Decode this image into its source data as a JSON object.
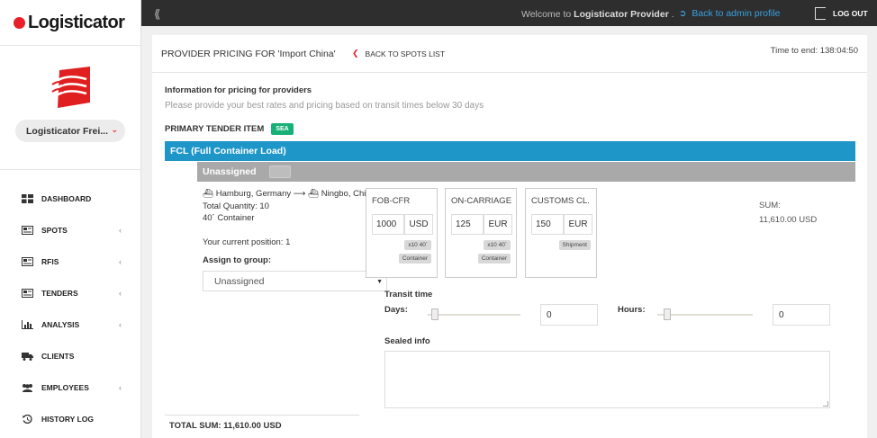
{
  "brand": {
    "name": "Logisticator",
    "accent": "#e8202a"
  },
  "sidebar": {
    "company_name": "Logisticator Frei...",
    "items": [
      {
        "label": "DASHBOARD",
        "icon": "dashboard-icon",
        "has_chevron": false
      },
      {
        "label": "SPOTS",
        "icon": "spots-icon",
        "has_chevron": true
      },
      {
        "label": "RFIS",
        "icon": "rfis-icon",
        "has_chevron": true
      },
      {
        "label": "TENDERS",
        "icon": "tenders-icon",
        "has_chevron": true
      },
      {
        "label": "ANALYSIS",
        "icon": "analysis-icon",
        "has_chevron": true
      },
      {
        "label": "CLIENTS",
        "icon": "clients-icon",
        "has_chevron": false
      },
      {
        "label": "EMPLOYEES",
        "icon": "employees-icon",
        "has_chevron": true
      },
      {
        "label": "HISTORY LOG",
        "icon": "history-icon",
        "has_chevron": false
      }
    ]
  },
  "topbar": {
    "welcome_prefix": "Welcome to",
    "welcome_name": "Logisticator Provider",
    "welcome_suffix": ".",
    "back_admin": "Back to admin profile",
    "logout": "LOG OUT",
    "link_color": "#3aa1e0"
  },
  "header": {
    "title": "PROVIDER PRICING FOR 'Import China'",
    "back_spots": "BACK TO SPOTS LIST",
    "time_to_end": "Time to end: 138:04:50"
  },
  "info": {
    "title": "Information for pricing for providers",
    "subtitle": "Please provide your best rates and pricing based on transit times below 30 days"
  },
  "tender": {
    "primary_label": "PRIMARY TENDER ITEM",
    "mode_badge": "SEA",
    "fcl_label": "FCL (Full Container Load)",
    "group_label": "Unassigned",
    "route_from": "Hamburg, Germany",
    "route_to": "Ningbo, China",
    "total_quantity": "Total Quantity: 10",
    "container": "40´ Container",
    "current_position": "Your current position: 1",
    "assign_label": "Assign to group:",
    "assign_value": "Unassigned",
    "costs": [
      {
        "title": "FOB-CFR",
        "value": "1000",
        "currency": "USD",
        "tag1": "x10 40´",
        "tag2": "Container"
      },
      {
        "title": "ON-CARRIAGE",
        "value": "125",
        "currency": "EUR",
        "tag1": "x10 40´",
        "tag2": "Container"
      },
      {
        "title": "CUSTOMS CL.",
        "value": "150",
        "currency": "EUR",
        "tag1": "Shipment"
      }
    ],
    "sum_label": "SUM:",
    "sum_value": "11,610.00 USD",
    "transit_label": "Transit time",
    "days_label": "Days:",
    "days_value": "0",
    "hours_label": "Hours:",
    "hours_value": "0",
    "sealed_label": "Sealed info",
    "total_sum": "TOTAL SUM: 11,610.00 USD",
    "fcl_color": "#1e96c8",
    "badge_color": "#17b178"
  }
}
